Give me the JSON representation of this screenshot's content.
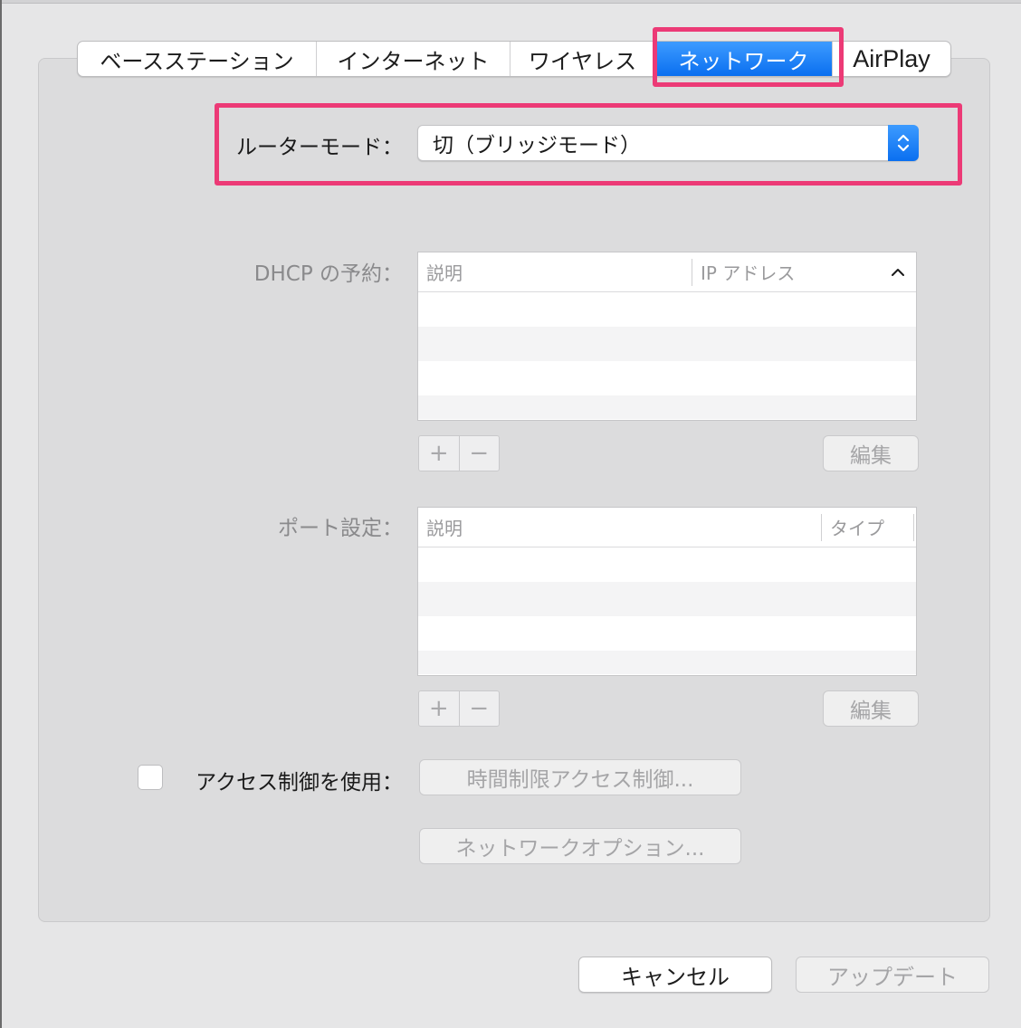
{
  "tabs": [
    {
      "label": "ベースステーション"
    },
    {
      "label": "インターネット"
    },
    {
      "label": "ワイヤレス"
    },
    {
      "label": "ネットワーク"
    },
    {
      "label": "AirPlay"
    }
  ],
  "selected_tab": "ネットワーク",
  "router_mode": {
    "label": "ルーターモード：",
    "value": "切（ブリッジモード）"
  },
  "dhcp": {
    "label": "DHCP の予約：",
    "columns": [
      "説明",
      "IP アドレス"
    ],
    "add_symbol": "+",
    "remove_symbol": "−",
    "edit_label": "編集"
  },
  "ports": {
    "label": "ポート設定：",
    "columns": [
      "説明",
      "タイプ"
    ],
    "add_symbol": "+",
    "remove_symbol": "−",
    "edit_label": "編集"
  },
  "access_control": {
    "label": "アクセス制御を使用：",
    "timed_button": "時間制限アクセス制御...",
    "network_options_button": "ネットワークオプション..."
  },
  "footer": {
    "cancel": "キャンセル",
    "update": "アップデート"
  },
  "colors": {
    "accent": "#0a6ff0",
    "highlight": "#ec3a76"
  }
}
